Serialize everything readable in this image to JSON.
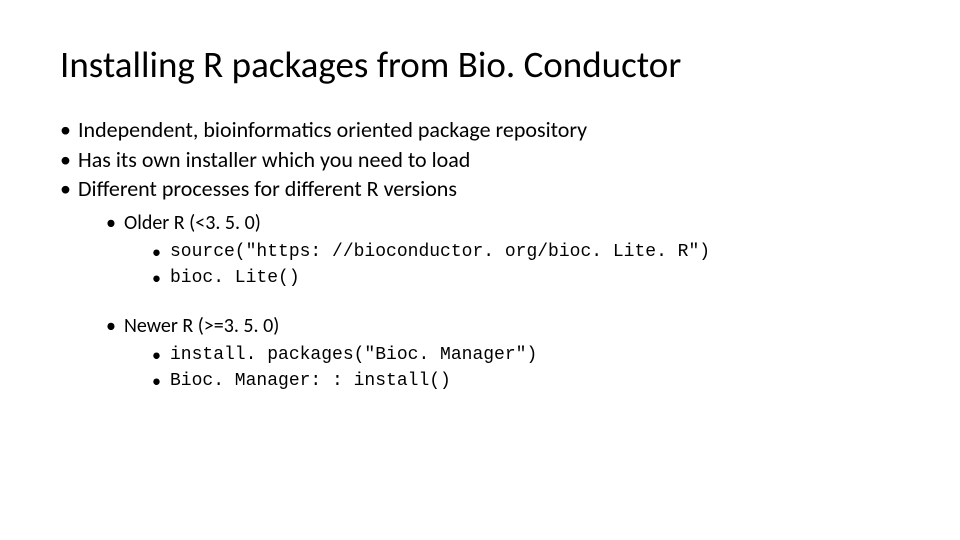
{
  "title": "Installing R packages from Bio. Conductor",
  "bullets": {
    "b1": "Independent, bioinformatics oriented package repository",
    "b2": "Has its own installer which you need to load",
    "b3": "Different processes for different R versions",
    "older": {
      "label": "Older R (<3. 5. 0)",
      "c1": "source(\"https: //bioconductor. org/bioc. Lite. R\")",
      "c2": "bioc. Lite()"
    },
    "newer": {
      "label": "Newer R (>=3. 5. 0)",
      "c1": "install. packages(\"Bioc. Manager\")",
      "c2": "Bioc. Manager: : install()"
    }
  }
}
